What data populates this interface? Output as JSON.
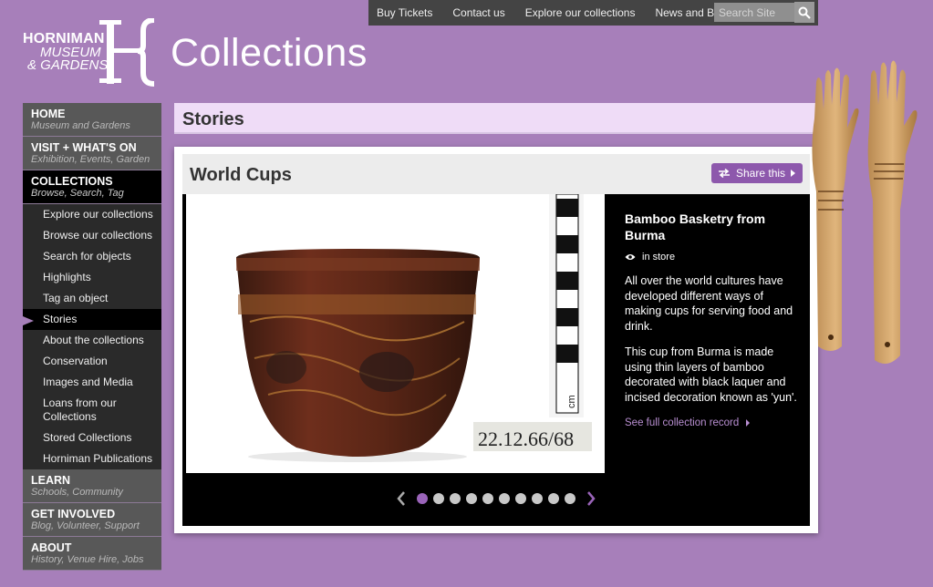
{
  "topnav": {
    "links": [
      "Buy Tickets",
      "Contact us",
      "Explore our collections",
      "News and Blog"
    ],
    "search_placeholder": "Search Site"
  },
  "logo": {
    "line1": "HORNIMAN",
    "line2": "MUSEUM",
    "line3": "& GARDENS",
    "title": "Collections"
  },
  "sidebar": {
    "sections_top": [
      {
        "title": "HOME",
        "subtitle": "Museum and Gardens"
      },
      {
        "title": "VISIT + WHAT'S ON",
        "subtitle": "Exhibition, Events, Garden"
      },
      {
        "title": "COLLECTIONS",
        "subtitle": "Browse, Search, Tag"
      }
    ],
    "collection_items": [
      "Explore our collections",
      "Browse our collections",
      "Search for objects",
      "Highlights",
      "Tag an object",
      "Stories",
      "About the collections",
      "Conservation",
      "Images and Media",
      "Loans from our Collections",
      "Stored Collections",
      "Horniman Publications"
    ],
    "current_item": "Stories",
    "sections_bottom": [
      {
        "title": "LEARN",
        "subtitle": "Schools, Community"
      },
      {
        "title": "GET INVOLVED",
        "subtitle": "Blog, Volunteer, Support"
      },
      {
        "title": "ABOUT",
        "subtitle": "History, Venue Hire, Jobs"
      }
    ]
  },
  "page": {
    "heading": "Stories"
  },
  "story": {
    "title": "World Cups",
    "share_label": "Share this",
    "object_title": "Bamboo Basketry from Burma",
    "status": "in store",
    "para1": "All over the world cultures have developed different ways of making cups for serving food and drink.",
    "para2": "This cup from Burma is made using thin layers of bamboo decorated with black laquer and incised decoration known as 'yun'.",
    "record_link": "See full collection record",
    "accession_number": "22.12.66/68",
    "scale_label": "cm"
  },
  "carousel": {
    "total": 10,
    "active": 1
  },
  "colors": {
    "background": "#a77fba",
    "accent": "#8d58ac",
    "link": "#b98fd2"
  }
}
